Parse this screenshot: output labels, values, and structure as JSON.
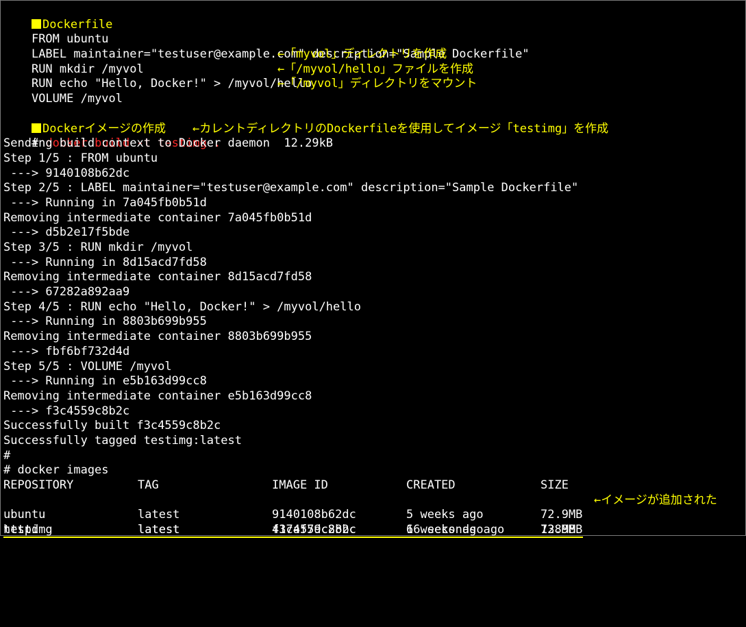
{
  "dockerfile_section": {
    "marker": "■",
    "heading": "Dockerfile",
    "lines": [
      {
        "code": "FROM ubuntu",
        "note": ""
      },
      {
        "code": "LABEL maintainer=\"testuser@example.com\" description=\"Sample Dockerfile\"",
        "note": ""
      },
      {
        "code": "RUN mkdir /myvol",
        "note": "←「myvol」ディレクトリを作成"
      },
      {
        "code": "RUN echo \"Hello, Docker!\" > /myvol/hello",
        "note": "←「/myvol/hello」ファイルを作成"
      },
      {
        "code": "VOLUME /myvol",
        "note": "←「/myvol」ディレクトリをマウント"
      }
    ]
  },
  "build_section": {
    "marker": "■",
    "heading": "Dockerイメージの作成",
    "prompt": "# ",
    "command": "docker build -t testimg .",
    "command_note": "←カレントディレクトリのDockerfileを使用してイメージ「testimg」を作成",
    "output": [
      "Sending build context to Docker daemon  12.29kB",
      "Step 1/5 : FROM ubuntu",
      " ---> 9140108b62dc",
      "Step 2/5 : LABEL maintainer=\"testuser@example.com\" description=\"Sample Dockerfile\"",
      " ---> Running in 7a045fb0b51d",
      "Removing intermediate container 7a045fb0b51d",
      " ---> d5b2e17f5bde",
      "Step 3/5 : RUN mkdir /myvol",
      " ---> Running in 8d15acd7fd58",
      "Removing intermediate container 8d15acd7fd58",
      " ---> 67282a892aa9",
      "Step 4/5 : RUN echo \"Hello, Docker!\" > /myvol/hello",
      " ---> Running in 8803b699b955",
      "Removing intermediate container 8803b699b955",
      " ---> fbf6bf732d4d",
      "Step 5/5 : VOLUME /myvol",
      " ---> Running in e5b163d99cc8",
      "Removing intermediate container e5b163d99cc8",
      " ---> f3c4559c8b2c",
      "Successfully built f3c4559c8b2c",
      "Successfully tagged testimg:latest",
      "#"
    ]
  },
  "images_section": {
    "command_line": "# docker images",
    "headers": [
      "REPOSITORY",
      "TAG",
      "IMAGE ID",
      "CREATED",
      "SIZE"
    ],
    "rows": [
      [
        "testimg",
        "latest",
        "f3c4559c8b2c",
        "16 seconds ago",
        "72.9MB"
      ],
      [
        "ubuntu",
        "latest",
        "9140108b62dc",
        "5 weeks ago",
        "72.9MB"
      ],
      [
        "httpd",
        "latest",
        "417af7dc28bc",
        "6 weeks ago",
        "138MB"
      ]
    ],
    "added_note": "←イメージが追加された"
  },
  "colors": {
    "background": "#000000",
    "text": "#ffffff",
    "annotation": "#ffff00",
    "command": "#ff2a2a"
  }
}
